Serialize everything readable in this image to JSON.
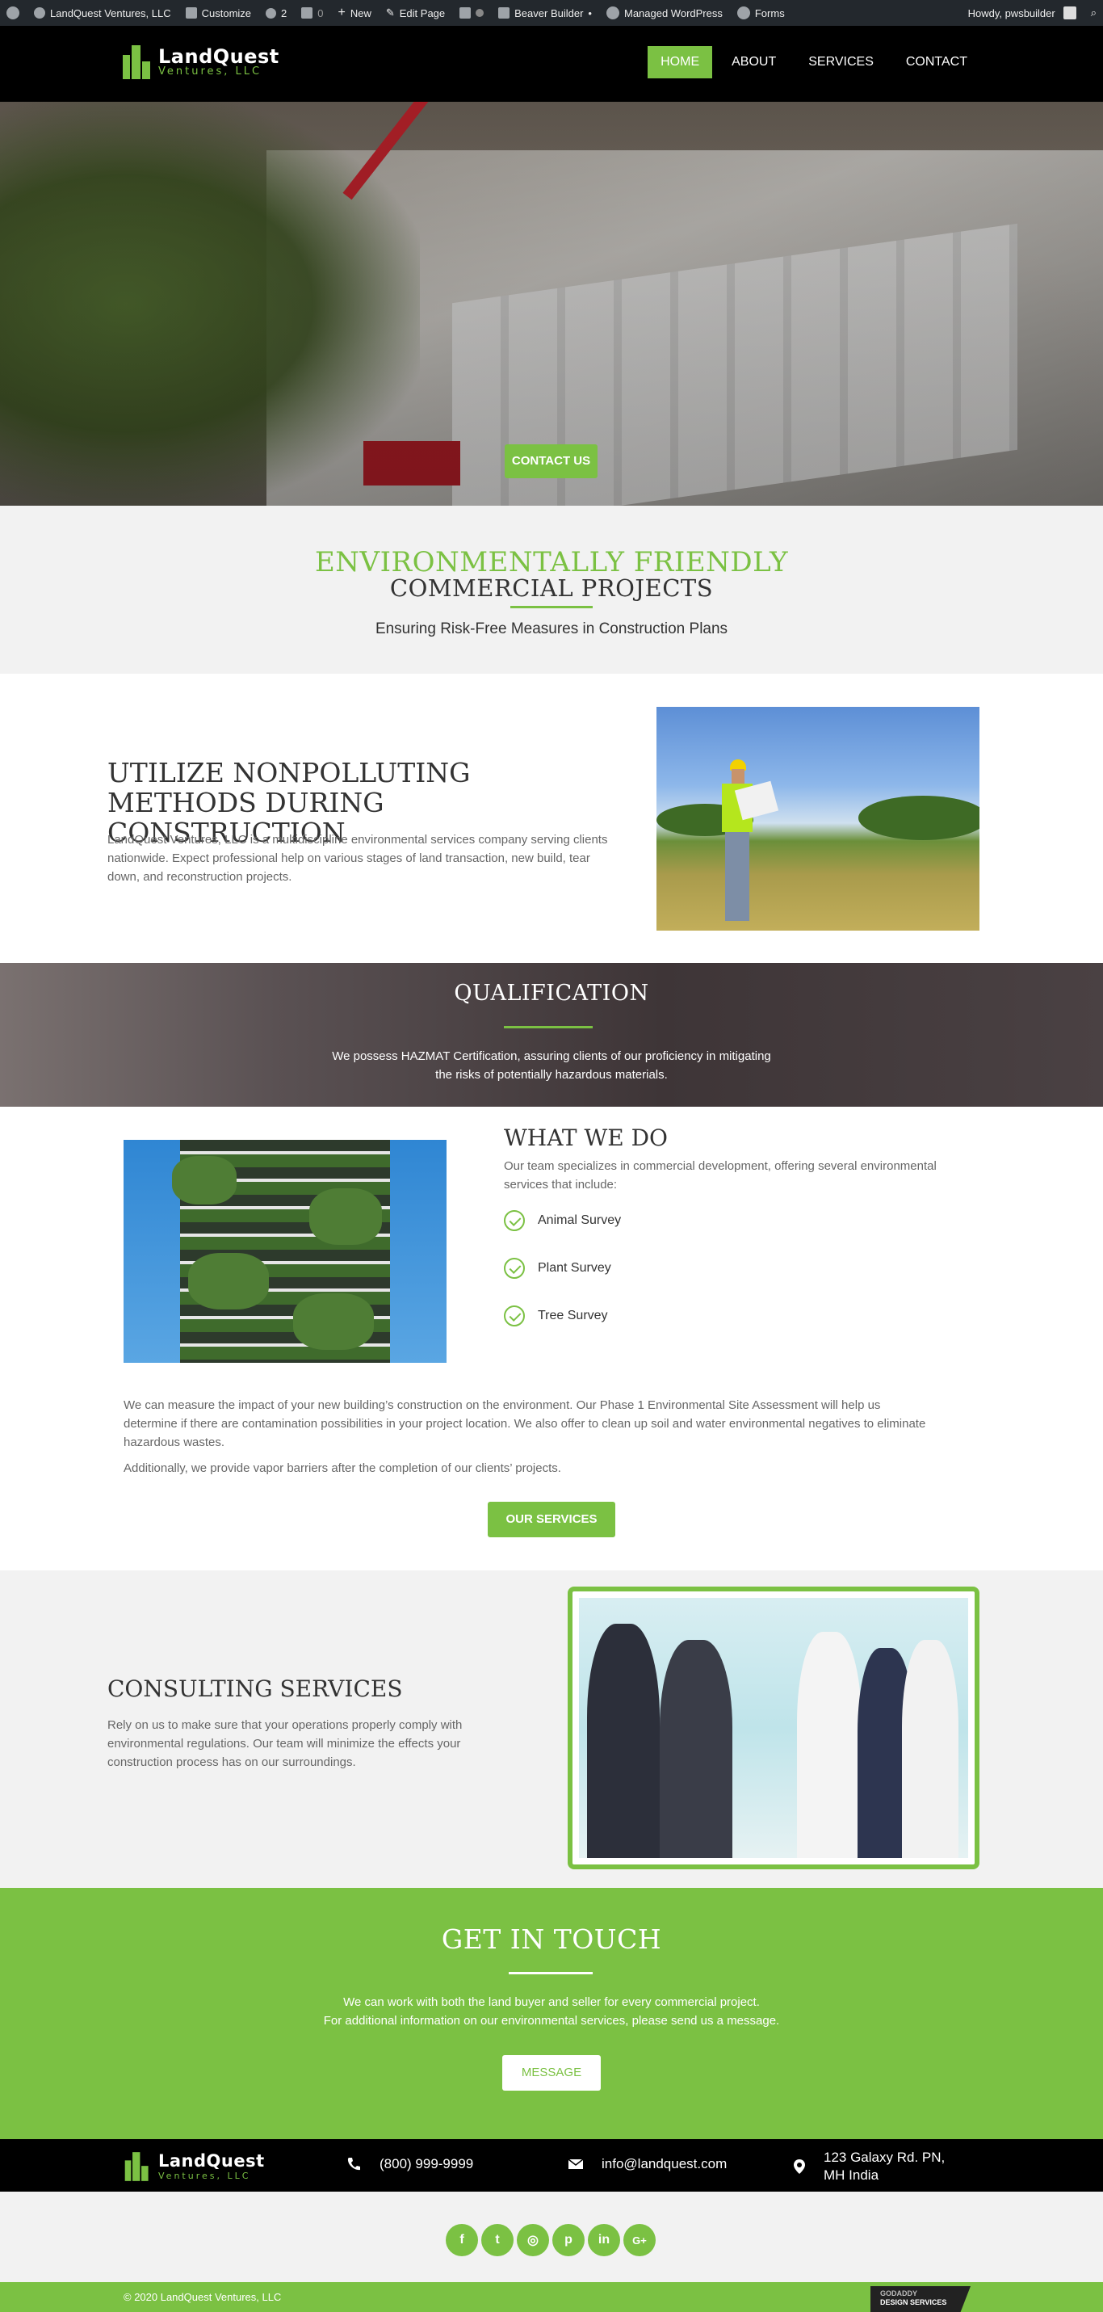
{
  "admin_bar": {
    "site_name": "LandQuest Ventures, LLC",
    "customize": "Customize",
    "updates_count": "2",
    "comments_count": "0",
    "new": "New",
    "edit_page": "Edit Page",
    "beaver_builder": "Beaver Builder",
    "managed_wordpress": "Managed WordPress",
    "forms": "Forms",
    "howdy": "Howdy, pwsbuilder"
  },
  "logo": {
    "line1": "LandQuest",
    "line2": "Ventures, LLC"
  },
  "nav": {
    "items": [
      {
        "label": "HOME"
      },
      {
        "label": "ABOUT"
      },
      {
        "label": "SERVICES"
      },
      {
        "label": "CONTACT"
      }
    ]
  },
  "hero": {
    "cta": "CONTACT US"
  },
  "intro": {
    "title_line1": "ENVIRONMENTALLY FRIENDLY",
    "title_line2": "COMMERCIAL PROJECTS",
    "subtitle": "Ensuring Risk-Free Measures in Construction Plans"
  },
  "utilize": {
    "heading": "UTILIZE NONPOLLUTING METHODS DURING CONSTRUCTION",
    "body": "LandQuest Ventures, LLC is a multidiscipline environmental services company serving clients nationwide. Expect professional help on various stages of land transaction, new build, tear down, and reconstruction projects."
  },
  "qualification": {
    "heading": "QUALIFICATION",
    "body": "We possess HAZMAT Certification, assuring clients of our proficiency in mitigating the risks of potentially hazardous materials."
  },
  "what_we_do": {
    "heading": "WHAT WE DO",
    "intro": "Our team specializes in commercial development, offering several environmental services that include:",
    "services": [
      "Animal Survey",
      "Plant Survey",
      "Tree Survey"
    ],
    "measure": "We can measure the impact of your new building’s construction on the environment. Our Phase 1 Environmental Site Assessment will help us determine if there are contamination possibilities in your project location. We also offer to clean up soil and water environmental negatives to eliminate hazardous wastes.",
    "vapor": "Additionally, we provide vapor barriers after the completion of our clients’ projects.",
    "cta": "OUR SERVICES"
  },
  "consulting": {
    "heading": "CONSULTING SERVICES",
    "body": "Rely on us to make sure that your operations properly comply with environmental regulations. Our team will minimize the effects your construction process has on our surroundings."
  },
  "touch": {
    "heading": "GET IN TOUCH",
    "line1": "We can work with both the land buyer and seller for every commercial project.",
    "line2": "For additional information on our environmental services, please send us a message.",
    "cta": "MESSAGE"
  },
  "footer": {
    "phone": "(800) 999-9999",
    "email": "info@landquest.com",
    "address": "123 Galaxy Rd. PN, MH India"
  },
  "social": {
    "icons": [
      "f",
      "t",
      "◎",
      "p",
      "in",
      "G+"
    ]
  },
  "copyright": "© 2020 LandQuest Ventures, LLC",
  "godaddy": {
    "line1": "GODADDY",
    "line2": "DESIGN SERVICES"
  },
  "colors": {
    "accent": "#7bc143",
    "dark": "#000000",
    "admin": "#23282d"
  }
}
